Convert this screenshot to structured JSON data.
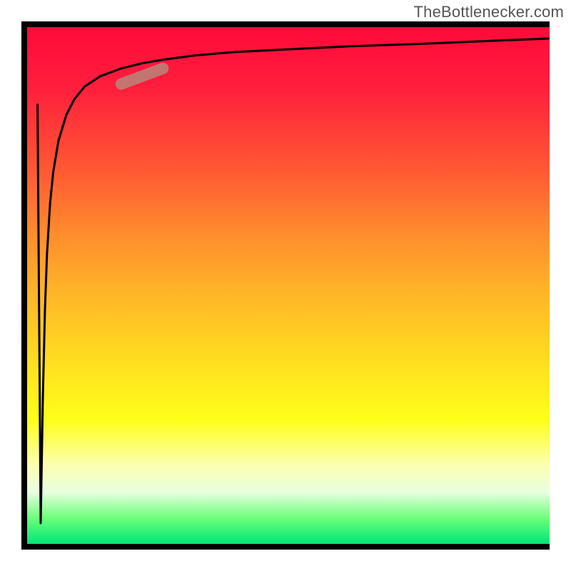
{
  "attribution": "TheBottlenecker.com",
  "chart_data": {
    "type": "line",
    "title": "",
    "xlabel": "",
    "ylabel": "",
    "xlim": [
      0,
      100
    ],
    "ylim": [
      0,
      100
    ],
    "series": [
      {
        "name": "bottleneck-curve",
        "x": [
          2.0,
          2.6,
          3.0,
          3.4,
          3.8,
          4.4,
          5.0,
          6.0,
          7.5,
          9.0,
          11.0,
          14.0,
          18.0,
          22.0,
          26.0,
          32.0,
          40.0,
          50.0,
          62.0,
          76.0,
          88.0,
          100.0
        ],
        "y": [
          85.0,
          4.0,
          28.0,
          45.0,
          56.0,
          66.0,
          72.0,
          78.0,
          83.0,
          86.0,
          88.5,
          90.5,
          92.0,
          93.0,
          93.7,
          94.5,
          95.2,
          95.7,
          96.3,
          96.8,
          97.3,
          97.8
        ]
      },
      {
        "name": "highlight-segment",
        "x": [
          18.0,
          26.0
        ],
        "y": [
          89.0,
          92.0
        ]
      }
    ],
    "gradient_stops": [
      {
        "pos": 0.0,
        "color": "#ff0a3a"
      },
      {
        "pos": 0.12,
        "color": "#ff1f3c"
      },
      {
        "pos": 0.28,
        "color": "#ff5a33"
      },
      {
        "pos": 0.4,
        "color": "#ff8c2d"
      },
      {
        "pos": 0.52,
        "color": "#ffb727"
      },
      {
        "pos": 0.66,
        "color": "#ffe21f"
      },
      {
        "pos": 0.76,
        "color": "#ffff1a"
      },
      {
        "pos": 0.85,
        "color": "#fbffb4"
      },
      {
        "pos": 0.9,
        "color": "#e8ffe0"
      },
      {
        "pos": 0.95,
        "color": "#6cff7a"
      },
      {
        "pos": 1.0,
        "color": "#00e676"
      }
    ],
    "highlight_color": "#bd8078",
    "curve_color": "#000000"
  }
}
